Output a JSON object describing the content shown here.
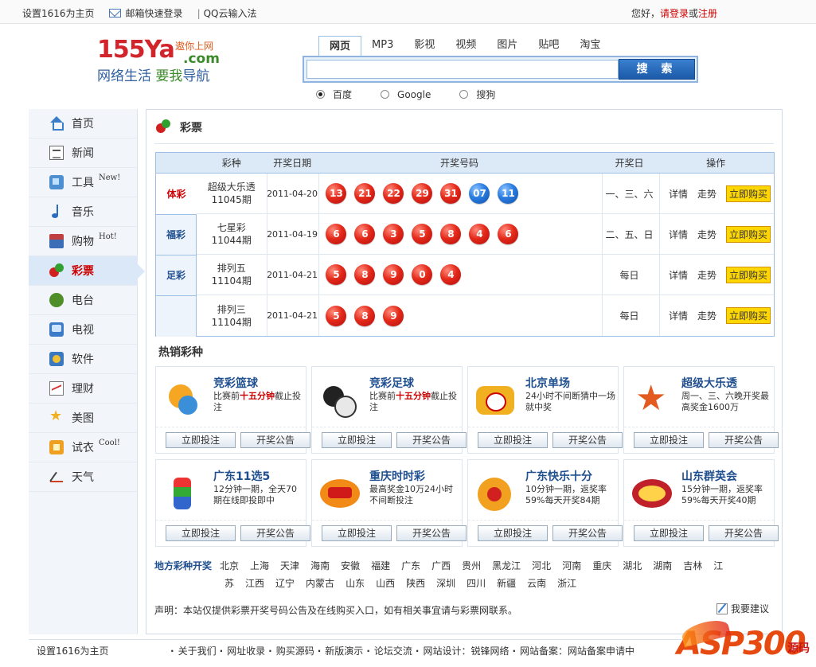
{
  "topbar": {
    "set_home": "设置1616为主页",
    "mail_login": "邮箱快速登录",
    "qq_input": "QQ云输入法",
    "greeting": "您好，",
    "login": "请登录",
    "or": "或",
    "register": "注册"
  },
  "logo": {
    "main": "155Ya",
    "dot_com": ".com",
    "tagline": "遨你上网",
    "slogan_a": "网络生活 ",
    "slogan_b": "要我",
    "slogan_c": "导航"
  },
  "search": {
    "tabs": [
      "网页",
      "MP3",
      "影视",
      "视频",
      "图片",
      "贴吧",
      "淘宝"
    ],
    "active_tab": 0,
    "value": "",
    "button": "搜 索",
    "engines": [
      "百度",
      "Google",
      "搜狗"
    ],
    "selected_engine": 0
  },
  "sidebar": {
    "items": [
      {
        "label": "首页",
        "tag": "",
        "icon": "home-icon"
      },
      {
        "label": "新闻",
        "tag": "",
        "icon": "news-icon"
      },
      {
        "label": "工具",
        "tag": "New!",
        "icon": "tool-icon"
      },
      {
        "label": "音乐",
        "tag": "",
        "icon": "music-icon"
      },
      {
        "label": "购物",
        "tag": "Hot!",
        "icon": "shop-icon"
      },
      {
        "label": "彩票",
        "tag": "",
        "icon": "lottery-icon"
      },
      {
        "label": "电台",
        "tag": "",
        "icon": "radio-icon"
      },
      {
        "label": "电视",
        "tag": "",
        "icon": "tv-icon"
      },
      {
        "label": "软件",
        "tag": "",
        "icon": "software-icon"
      },
      {
        "label": "理财",
        "tag": "",
        "icon": "finance-icon"
      },
      {
        "label": "美图",
        "tag": "",
        "icon": "picture-icon"
      },
      {
        "label": "试衣",
        "tag": "Cool!",
        "icon": "dress-icon"
      },
      {
        "label": "天气",
        "tag": "",
        "icon": "weather-icon"
      }
    ],
    "active": 5
  },
  "main": {
    "title": "彩票",
    "table": {
      "headers": [
        "彩种",
        "开奖日期",
        "开奖号码",
        "开奖日",
        "操作"
      ],
      "categories": [
        "体彩",
        "福彩",
        "足彩",
        ""
      ],
      "rows": [
        {
          "name": "超级大乐透",
          "issue": "11045期",
          "date": "2011-04-20",
          "red": [
            "13",
            "21",
            "22",
            "29",
            "31"
          ],
          "blue": [
            "07",
            "11"
          ],
          "days": "一、三、六"
        },
        {
          "name": "七星彩",
          "issue": "11044期",
          "date": "2011-04-19",
          "red": [
            "6",
            "6",
            "3",
            "5",
            "8",
            "4",
            "6"
          ],
          "blue": [],
          "days": "二、五、日"
        },
        {
          "name": "排列五",
          "issue": "11104期",
          "date": "2011-04-21",
          "red": [
            "5",
            "8",
            "9",
            "0",
            "4"
          ],
          "blue": [],
          "days": "每日"
        },
        {
          "name": "排列三",
          "issue": "11104期",
          "date": "2011-04-21",
          "red": [
            "5",
            "8",
            "9"
          ],
          "blue": [],
          "days": "每日"
        }
      ],
      "op_detail": "详情",
      "op_trend": "走势",
      "op_buy": "立即购买"
    },
    "hot_title": "热销彩种",
    "cards": [
      {
        "title": "竞彩篮球",
        "desc_a": "比赛前",
        "desc_b": "十五分钟",
        "desc_c": "截止投注"
      },
      {
        "title": "竞彩足球",
        "desc_a": "比赛前",
        "desc_b": "十五分钟",
        "desc_c": "截止投注"
      },
      {
        "title": "北京单场",
        "desc_a": "24小时不间断猜中一场就中奖",
        "desc_b": "",
        "desc_c": ""
      },
      {
        "title": "超级大乐透",
        "desc_a": "周一、三、六晚开奖最高奖金1600万",
        "desc_b": "",
        "desc_c": ""
      },
      {
        "title": "广东11选5",
        "desc_a": "12分钟一期，全天70期在线即投即中",
        "desc_b": "",
        "desc_c": ""
      },
      {
        "title": "重庆时时彩",
        "desc_a": "最高奖金10万24小时不间断投注",
        "desc_b": "",
        "desc_c": ""
      },
      {
        "title": "广东快乐十分",
        "desc_a": "10分钟一期，返奖率59%每天开奖84期",
        "desc_b": "",
        "desc_c": ""
      },
      {
        "title": "山东群英会",
        "desc_a": "15分钟一期，返奖率59%每天开奖40期",
        "desc_b": "",
        "desc_c": ""
      }
    ],
    "card_btn_bet": "立即投注",
    "card_btn_notice": "开奖公告",
    "regions_label": "地方彩种开奖",
    "regions_row1": [
      "北京",
      "上海",
      "天津",
      "海南",
      "安徽",
      "福建",
      "广东",
      "广西",
      "贵州",
      "黑龙江",
      "河北",
      "河南",
      "重庆",
      "湖北",
      "湖南",
      "吉林",
      "江"
    ],
    "regions_row2": [
      "苏",
      "江西",
      "辽宁",
      "内蒙古",
      "山东",
      "山西",
      "陕西",
      "深圳",
      "四川",
      "新疆",
      "云南",
      "浙江"
    ],
    "notice": "声明：本站仅提供彩票开奖号码公告及在线购买入口，如有相关事宜请与彩票网联系。",
    "suggest": "我要建议"
  },
  "footer": {
    "set_home": "设置1616为主页",
    "links": [
      "关于我们",
      "网址收录",
      "购买源码",
      "新版演示",
      "论坛交流",
      "网站设计：锐锋网络",
      "网站备案：网站备案申请中"
    ]
  },
  "watermark": {
    "main": "ASP300",
    "sub": "源码"
  }
}
